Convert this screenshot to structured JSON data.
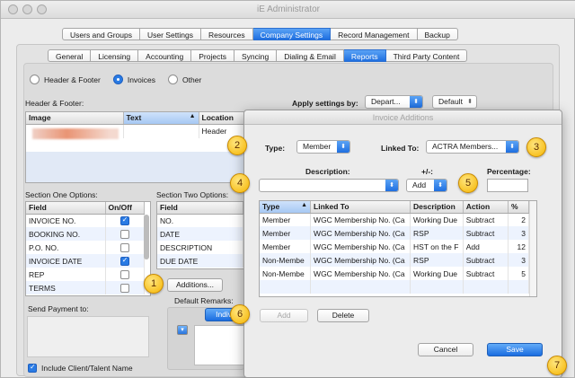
{
  "window": {
    "title": "iE Administrator"
  },
  "top_tabs": [
    {
      "label": "Users and Groups",
      "active": false
    },
    {
      "label": "User Settings",
      "active": false
    },
    {
      "label": "Resources",
      "active": false
    },
    {
      "label": "Company Settings",
      "active": true
    },
    {
      "label": "Record Management",
      "active": false
    },
    {
      "label": "Backup",
      "active": false
    }
  ],
  "sub_tabs": [
    {
      "label": "General",
      "active": false
    },
    {
      "label": "Licensing",
      "active": false
    },
    {
      "label": "Accounting",
      "active": false
    },
    {
      "label": "Projects",
      "active": false
    },
    {
      "label": "Syncing",
      "active": false
    },
    {
      "label": "Dialing & Email",
      "active": false
    },
    {
      "label": "Reports",
      "active": true
    },
    {
      "label": "Third Party Content",
      "active": false
    }
  ],
  "report_type": {
    "options": [
      "Header & Footer",
      "Invoices",
      "Other"
    ],
    "selected": "Invoices"
  },
  "header_footer": {
    "label": "Header & Footer:",
    "columns": [
      "Image",
      "Text",
      "Location"
    ],
    "row_location": "Header",
    "apply_label": "Apply settings by:",
    "apply_value": "Depart...",
    "default_value": "Default"
  },
  "section_one": {
    "label": "Section One Options:",
    "columns": [
      "Field",
      "On/Off"
    ],
    "rows": [
      {
        "field": "INVOICE NO.",
        "on": true
      },
      {
        "field": "BOOKING NO.",
        "on": false
      },
      {
        "field": "P.O. NO.",
        "on": false
      },
      {
        "field": "INVOICE DATE",
        "on": true
      },
      {
        "field": "REP",
        "on": false
      },
      {
        "field": "TERMS",
        "on": false
      }
    ]
  },
  "section_two": {
    "label": "Section Two Options:",
    "columns": [
      "Field"
    ],
    "rows": [
      "NO.",
      "DATE",
      "DESCRIPTION",
      "DUE DATE"
    ],
    "additions_button": "Additions...",
    "default_remarks_label": "Default Remarks:",
    "individual_button": "Indivi"
  },
  "send_payment": {
    "label": "Send Payment to:",
    "include_label": "Include Client/Talent Name",
    "include_checked": true
  },
  "dialog": {
    "title": "Invoice Additions",
    "type_label": "Type:",
    "type_value": "Member",
    "linked_to_label": "Linked To:",
    "linked_to_value": "ACTRA Members...",
    "description_label": "Description:",
    "description_value": "",
    "plus_minus_label": "+/-:",
    "plus_minus_value": "Add",
    "percentage_label": "Percentage:",
    "percentage_value": "",
    "columns": [
      "Type",
      "Linked To",
      "Description",
      "Action",
      "%"
    ],
    "rows": [
      {
        "type": "Member",
        "linked_to": "WGC Membership No. (Ca",
        "description": "Working Due",
        "action": "Subtract",
        "percent": "2"
      },
      {
        "type": "Member",
        "linked_to": "WGC Membership No. (Ca",
        "description": "RSP",
        "action": "Subtract",
        "percent": "3"
      },
      {
        "type": "Member",
        "linked_to": "WGC Membership No. (Ca",
        "description": "HST on the F",
        "action": "Add",
        "percent": "12"
      },
      {
        "type": "Non-Membe",
        "linked_to": "WGC Membership No. (Ca",
        "description": "RSP",
        "action": "Subtract",
        "percent": "3"
      },
      {
        "type": "Non-Membe",
        "linked_to": "WGC Membership No. (Ca",
        "description": "Working Due",
        "action": "Subtract",
        "percent": "5"
      }
    ],
    "add_button": "Add",
    "delete_button": "Delete",
    "cancel_button": "Cancel",
    "save_button": "Save"
  },
  "callouts": [
    "1",
    "2",
    "3",
    "4",
    "5",
    "6",
    "7"
  ],
  "colors": {
    "accent": "#1f6fe0",
    "callout": "#f5b400"
  }
}
